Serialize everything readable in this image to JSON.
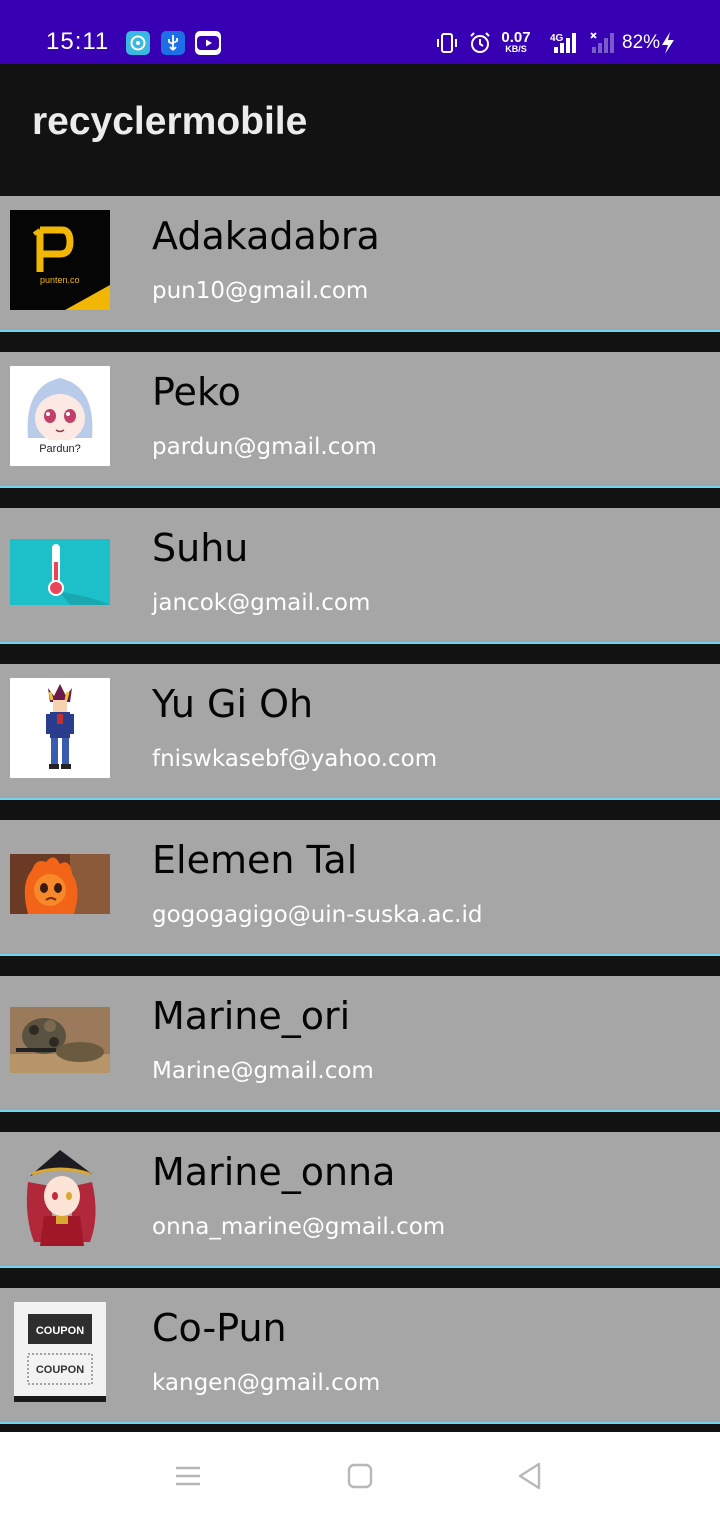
{
  "status_bar": {
    "time": "15:11",
    "notification_icons": [
      "chat-app-icon",
      "usb-icon",
      "youtube-icon"
    ],
    "net_speed_value": "0.07",
    "net_speed_unit": "KB/S",
    "network_type": "4G",
    "battery_percent": "82%",
    "colors": {
      "background": "#3700B3"
    }
  },
  "app_bar": {
    "title": "recyclermobile"
  },
  "contacts": [
    {
      "name": "Adakadabra",
      "email": "pun10@gmail.com",
      "avatar": "punten-logo-thumbnail"
    },
    {
      "name": "Peko",
      "email": "pardun@gmail.com",
      "avatar": "anime-girl-pardun-thumbnail"
    },
    {
      "name": "Suhu",
      "email": "jancok@gmail.com",
      "avatar": "thermometer-thumbnail"
    },
    {
      "name": "Yu Gi Oh",
      "email": "fniswkasebf@yahoo.com",
      "avatar": "pixel-character-thumbnail"
    },
    {
      "name": "Elemen Tal",
      "email": "gogogagigo@uin-suska.ac.id",
      "avatar": "fire-character-thumbnail"
    },
    {
      "name": "Marine_ori",
      "email": "Marine@gmail.com",
      "avatar": "soldier-camouflage-thumbnail"
    },
    {
      "name": "Marine_onna",
      "email": "onna_marine@gmail.com",
      "avatar": "pirate-anime-girl-thumbnail"
    },
    {
      "name": "Co-Pun",
      "email": "kangen@gmail.com",
      "avatar": "coupon-thumbnail"
    }
  ],
  "coupon_text": "COUPON",
  "logo_text": "punten.co",
  "pardun_text": "Pardun?",
  "nav_bar": {
    "buttons": [
      "menu-icon",
      "home-icon",
      "back-icon"
    ]
  },
  "colors": {
    "list_background": "#121212",
    "item_background": "#a6a6a6",
    "item_divider": "#6fd4f0",
    "name_text": "#050505",
    "email_text": "#ffffff"
  }
}
